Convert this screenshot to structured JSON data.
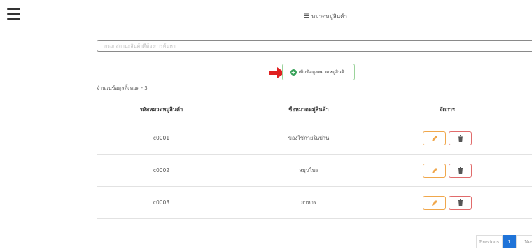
{
  "header": {
    "title": "หมวดหมู่สินค้า",
    "title_icon": "list-icon",
    "menu_icon": "hamburger-icon"
  },
  "search": {
    "placeholder": "กรอกสถานะสินค้าที่ต้องการค้นหา",
    "value": ""
  },
  "add_button": {
    "label": "เพิ่มข้อมูลหมวดหมู่สินค้า",
    "icon": "plus-circle-icon",
    "pointer_icon": "red-arrow-icon"
  },
  "summary": {
    "total_label": "จำนวนข้อมูลทั้งหมด - 3"
  },
  "table": {
    "headers": [
      "รหัสหมวดหมู่สินค้า",
      "ชื่อหมวดหมู่สินค้า",
      "จัดการ"
    ],
    "rows": [
      {
        "code": "c0001",
        "name": "ของใช้ภายในบ้าน"
      },
      {
        "code": "c0002",
        "name": "สมุนไพร"
      },
      {
        "code": "c0003",
        "name": "อาหาร"
      }
    ],
    "edit_icon": "pencil-icon",
    "delete_icon": "trash-icon"
  },
  "pagination": {
    "previous": "Previous",
    "current": "1",
    "next": "Next"
  },
  "colors": {
    "add_border": "#9bd39b",
    "plus_green": "#3aa35b",
    "edit_orange": "#f0a74c",
    "delete_red": "#e16b6b",
    "arrow_red": "#e02020",
    "page_active": "#1f73d8"
  }
}
